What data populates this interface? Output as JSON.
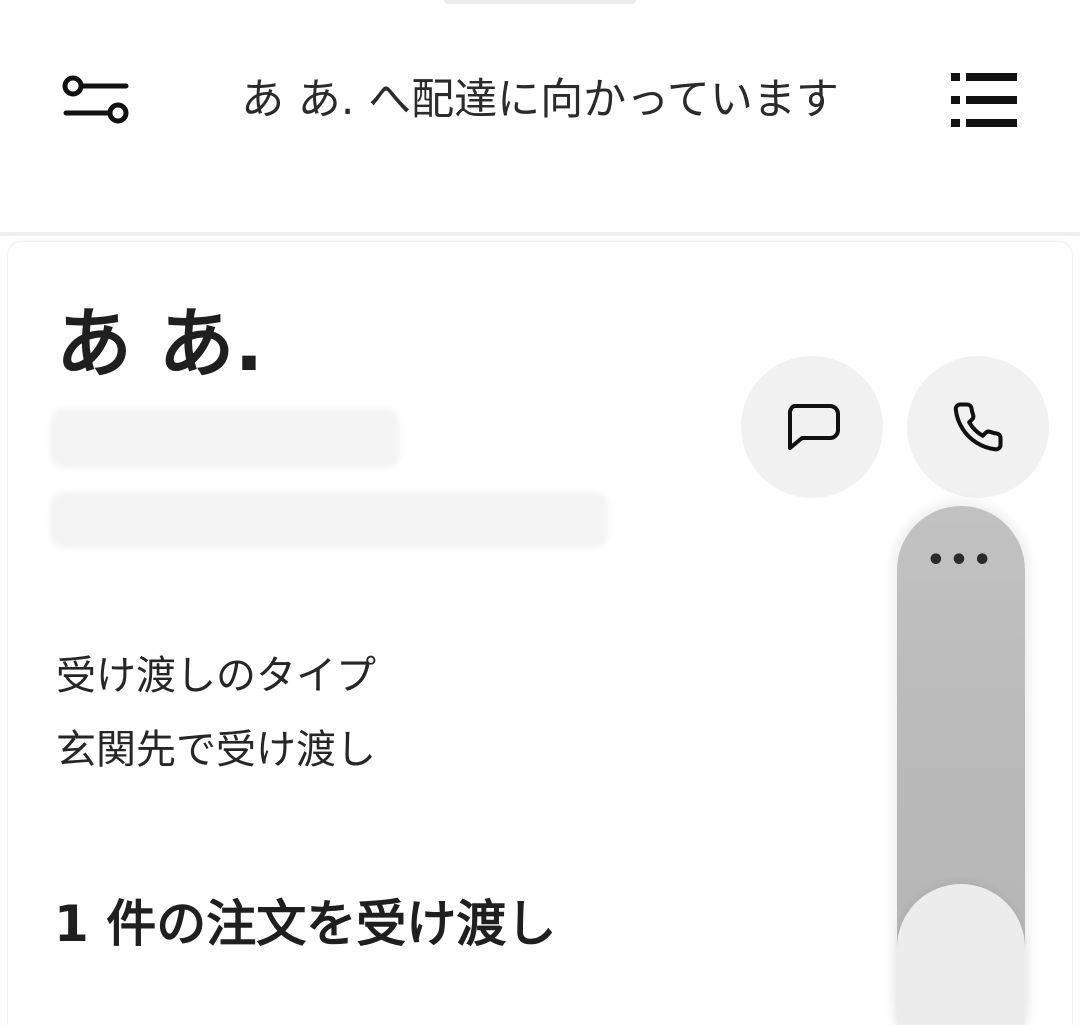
{
  "header": {
    "title": "あ あ. へ配達に向かっています",
    "filter_icon": "filter-toggle-icon",
    "list_icon": "list-icon"
  },
  "customer": {
    "name": "あ あ."
  },
  "contact": {
    "chat_icon": "chat-bubble-icon",
    "call_icon": "phone-icon"
  },
  "handoff": {
    "label": "受け渡しのタイプ",
    "value": "玄関先で受け渡し"
  },
  "orders": {
    "heading": "1 件の注文を受け渡し"
  },
  "slider": {
    "dots": "•••",
    "more_icon": "more-dots-icon"
  },
  "colors": {
    "background": "#ffffff",
    "text": "#1f1f1f",
    "button_bg": "#f1f1f1",
    "slider_track": "#bababa",
    "slider_thumb": "#ececec"
  }
}
